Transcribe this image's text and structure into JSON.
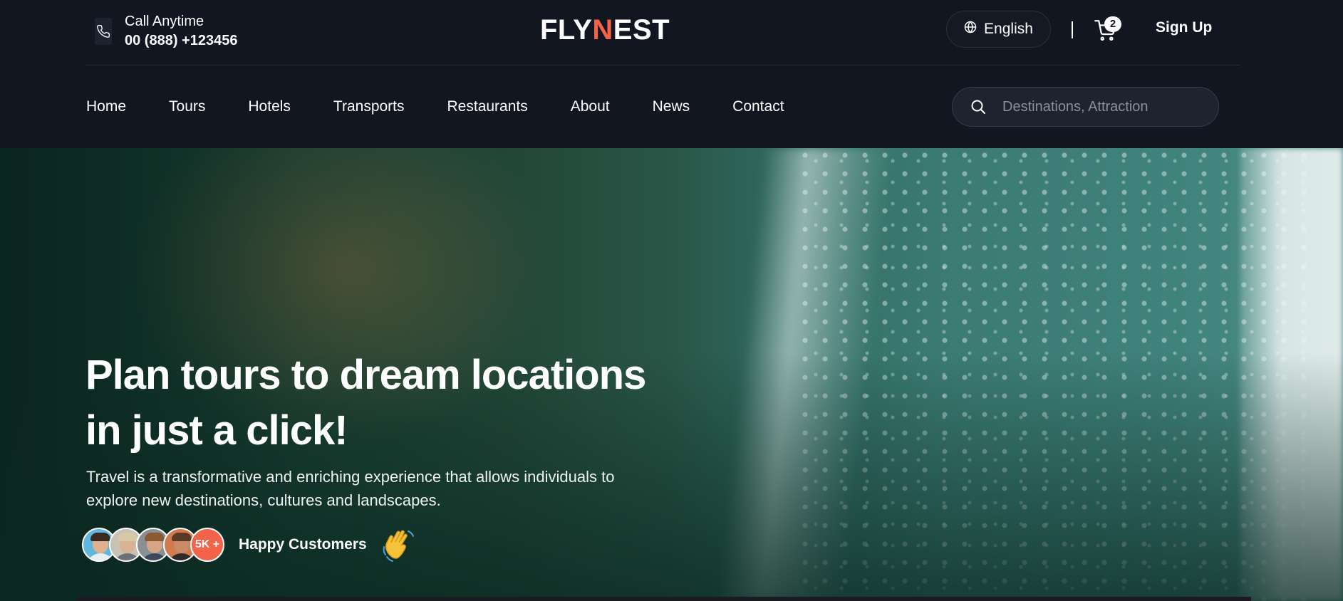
{
  "header": {
    "call_label": "Call Anytime",
    "call_number": "00 (888) +123456",
    "logo_prefix": "FLY",
    "logo_accent": "N",
    "logo_suffix": "EST",
    "language": "English",
    "cart_count": "2",
    "signup_label": "Sign Up"
  },
  "nav": {
    "items": [
      {
        "label": "Home"
      },
      {
        "label": "Tours"
      },
      {
        "label": "Hotels"
      },
      {
        "label": "Transports"
      },
      {
        "label": "Restaurants"
      },
      {
        "label": "About"
      },
      {
        "label": "News"
      },
      {
        "label": "Contact"
      }
    ]
  },
  "search": {
    "placeholder": "Destinations, Attraction",
    "value": ""
  },
  "hero": {
    "title": "Plan tours to dream locations in just a click!",
    "description": "Travel is a transformative and enriching experience that allows individuals to explore new destinations, cultures and landscapes.",
    "customers_count": "5K +",
    "customers_label": "Happy Customers"
  },
  "icons": {
    "phone": "phone-icon",
    "globe": "globe-icon",
    "cart": "cart-icon",
    "search": "search-icon",
    "wave": "waving-hand-icon"
  },
  "colors": {
    "accent": "#f2634a",
    "background": "#121620",
    "text": "#ffffff"
  }
}
